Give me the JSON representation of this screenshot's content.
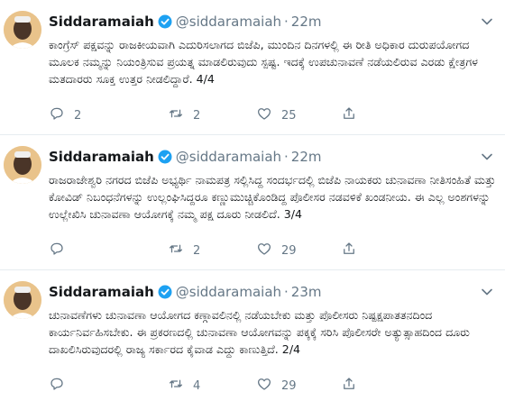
{
  "tweets": [
    {
      "name": "Siddaramaiah",
      "handle": "@siddaramaiah",
      "separator": "·",
      "time": "22m",
      "text": "ಕಾಂಗ್ರೆಸ್ ಪಕ್ಷವನ್ನು ರಾಜಕೀಯವಾಗಿ ಎದುರಿಸಲಾಗದ ಬಿಜೆಪಿ, ಮುಂದಿನ ದಿನಗಳಲ್ಲಿ ಈ ರೀತಿ ಅಧಿಕಾರ ದುರುಪಯೋಗದ ಮೂಲಕ ನಮ್ಮನ್ನು ನಿಯಂತ್ರಿಸುವ ಪ್ರಯತ್ನ ಮಾಡಲಿರುವುದು ಸ್ಪಷ್ಟ. ಇದಕ್ಕೆ ಉಪಚುನಾವಣೆ ನಡೆಯಲಿರುವ ಎರಡು ಕ್ಷೇತ್ರಗಳ ಮತದಾರರು ಸೂಕ್ತ ಉತ್ತರ ನೀಡಲಿದ್ದಾರೆ. 4/4",
      "replies": "2",
      "retweets": "2",
      "likes": "25"
    },
    {
      "name": "Siddaramaiah",
      "handle": "@siddaramaiah",
      "separator": "·",
      "time": "22m",
      "text": "ರಾಜರಾಜೇಶ್ವರಿ ನಗರದ ಬಿಜೆಪಿ ಅಭ್ಯರ್ಥಿ ನಾಮಪತ್ರ ಸಲ್ಲಿಸಿದ್ದ ಸಂದರ್ಭದಲ್ಲಿ ಬಿಜೆಪಿ ನಾಯಕರು ಚುನಾವಣಾ ನೀತಿಸಂಹಿತೆ ಮತ್ತು ಕೋವಿಡ್ ನಿಬಂಧನೆಗಳನ್ನು ಉಲ್ಲಂಘಿಸಿದ್ದರೂ ಕಣ್ಣುಮುಚ್ಚಿಕೊಂಡಿದ್ದ ಪೊಲೀಸರ ನಡವಳಿಕೆ ಖಂಡನೀಯ. ಈ ಎಲ್ಲ ಅಂಶಗಳನ್ನು ಉಲ್ಲೇಖಿಸಿ ಚುನಾವಣಾ ಆಯೋಗಕ್ಕೆ ನಮ್ಮ ಪಕ್ಷ ದೂರು ನೀಡಲಿದೆ. 3/4",
      "replies": "",
      "retweets": "2",
      "likes": "29"
    },
    {
      "name": "Siddaramaiah",
      "handle": "@siddaramaiah",
      "separator": "·",
      "time": "23m",
      "text": "ಚುನಾವಣೆಗಳು ಚುನಾವಣಾ ಆಯೋಗದ ಕಣ್ಗಾವಲಿನಲ್ಲಿ ನಡೆಯಬೇಕು ಮತ್ತು ಪೊಲೀಸರು ನಿಷ್ಪಕ್ಷಪಾತತನದಿಂದ ಕಾರ್ಯನಿರ್ವಹಿಸಬೇಕು. ಈ ಪ್ರಕರಣದಲ್ಲಿ ಚುನಾವಣಾ ಆಯೋಗವನ್ನು ಪಕ್ಕಕ್ಕೆ ಸರಿಸಿ ಪೊಲೀಸರೇ ಅತ್ಯುತ್ಸಾಹದಿಂದ ದೂರು ದಾಖಲಿಸಿರುವುದರಲ್ಲಿ ರಾಜ್ಯ ಸರ್ಕಾರದ ಕೈವಾಡ ಎದ್ದು ಕಾಣುತ್ತಿದೆ. 2/4",
      "replies": "",
      "retweets": "4",
      "likes": "29"
    }
  ],
  "icons": {
    "reply": "reply-icon",
    "retweet": "retweet-icon",
    "like": "heart-icon",
    "share": "share-icon",
    "verified": "verified-badge-icon",
    "more": "chevron-down-icon"
  },
  "colors": {
    "verified": "#1da1f2",
    "muted": "#657786",
    "divider": "#e6ecf0"
  }
}
